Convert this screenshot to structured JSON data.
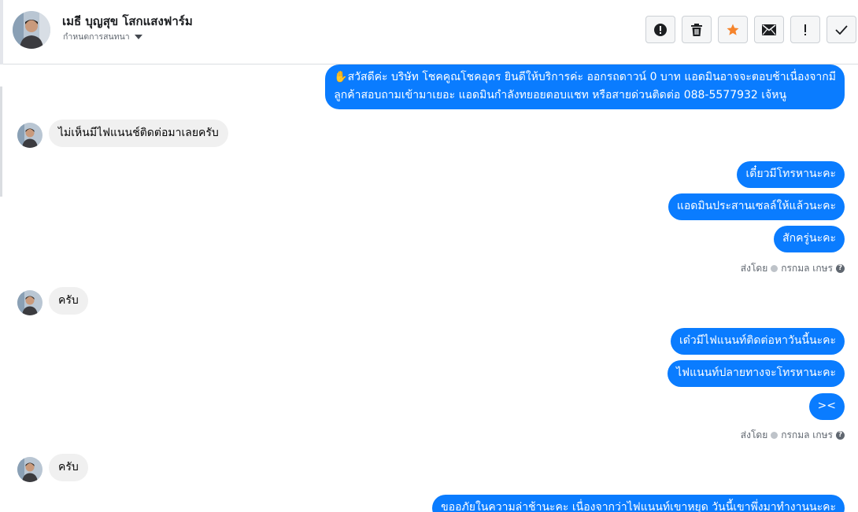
{
  "header": {
    "contact_name": "เมธี บุญสุข โสกแสงฟาร์ม",
    "assign_label": "กำหนดการสนทนา",
    "toolbar": [
      "alert-icon",
      "trash-icon",
      "star-icon",
      "mail-icon",
      "exclamation-icon",
      "check-icon"
    ],
    "star_color": "#f5842c"
  },
  "messages": {
    "out_1": {
      "line1": "✋สวัสดีค่ะ บริษัท โชคคูณโชคอุดร ยินดีให้บริการค่ะ ออกรถดาวน์ 0 บาท แอดมินอาจจะตอบช้าเนื่องจากมี",
      "line2": "ลูกค้าสอบถามเข้ามาเยอะ แอดมินกำลังทยอยตอบแชท หรือสายด่วนติดต่อ 088-5577932 เจ้หนู"
    },
    "in_1": "ไม่เห็นมีไฟแนนช์ติดต่อมาเลยครับ",
    "out_2": "เดี๋ยวมีโทรหานะคะ",
    "out_3": "แอดมินประสานเซลล์ให้แล้วนะคะ",
    "out_4": "สักครู่นะคะ",
    "sent_by_1": {
      "prefix": "ส่งโดย",
      "name": "กรกมล เกษร"
    },
    "in_2": "ครับ",
    "out_5": "เด๋วมีไฟแนนท์ติดต่อหาวันนี้นะคะ",
    "out_6": "ไฟแนนท์ปลายทางจะโทรหานะคะ",
    "out_7": "><",
    "sent_by_2": {
      "prefix": "ส่งโดย",
      "name": "กรกมล เกษร"
    },
    "in_3": "ครับ",
    "out_8": "ขออภัยในความล่าช้านะคะ เนื่องจากว่าไฟแนนท์เขาหยุด วันนี้เขาพึ่งมาทำงานนะคะ"
  },
  "colors": {
    "outgoing_bubble": "#0a7cff",
    "incoming_bubble": "#f0f0f0"
  }
}
